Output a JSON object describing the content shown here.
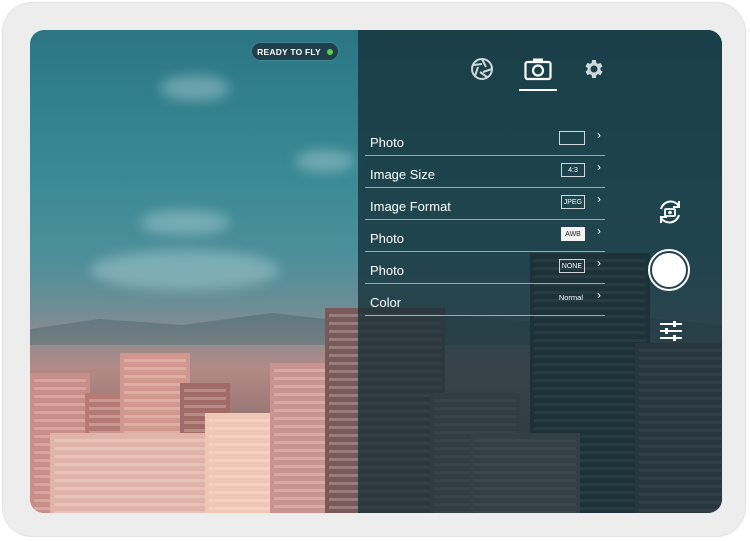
{
  "status": {
    "label": "READY TO FLY",
    "color": "#54d24b"
  },
  "tabs": [
    {
      "name": "aperture-icon",
      "active": false
    },
    {
      "name": "camera-icon",
      "active": true
    },
    {
      "name": "gear-icon",
      "active": false
    }
  ],
  "settings": {
    "rows": [
      {
        "label": "Photo",
        "value": ""
      },
      {
        "label": "Image Size",
        "value": "4:3"
      },
      {
        "label": "Image Format",
        "value": "JPEG"
      },
      {
        "label": "Photo",
        "value": "AWB"
      },
      {
        "label": "Photo",
        "value": "NONE"
      },
      {
        "label": "Color",
        "value": "Normal"
      }
    ]
  },
  "controls": {
    "switch_camera_icon": "camera-switch-icon",
    "shutter_icon": "shutter-button",
    "adjust_icon": "sliders-icon"
  }
}
